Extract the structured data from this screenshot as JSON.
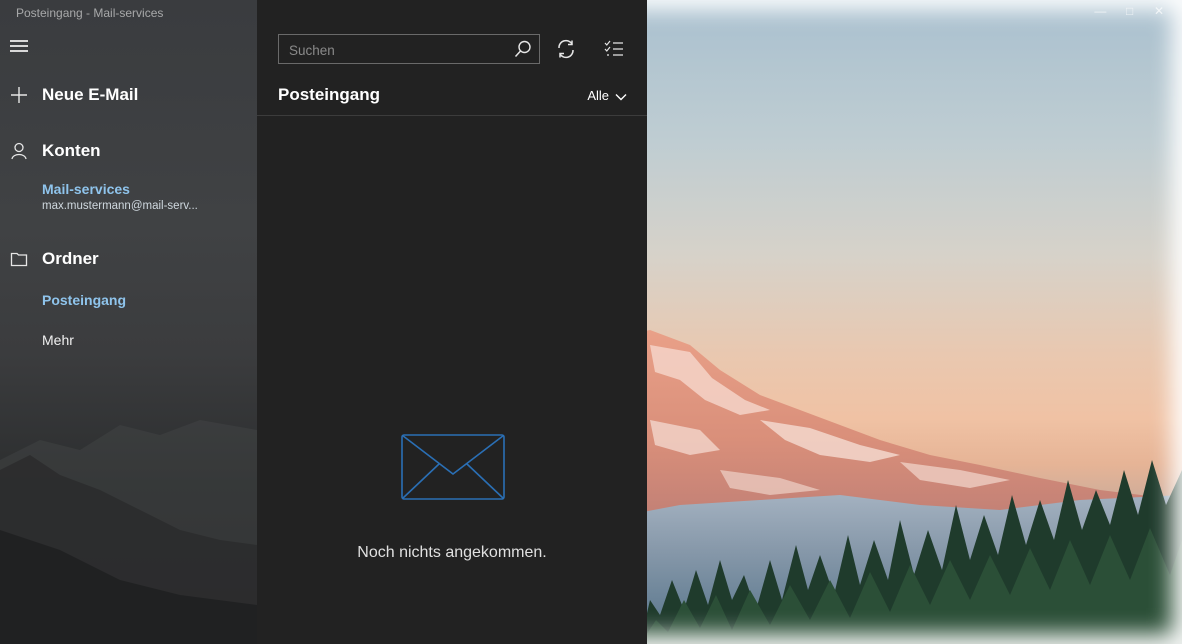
{
  "window": {
    "title": "Posteingang - Mail-services",
    "controls": [
      "—",
      "□",
      "✕"
    ]
  },
  "nav": {
    "menu_icon": "hamburger-icon",
    "new_mail": {
      "label": "Neue E-Mail",
      "icon": "plus-icon"
    },
    "accounts": {
      "label": "Konten",
      "icon": "person-icon",
      "items": [
        {
          "name": "Mail-services",
          "email": "max.mustermann@mail-serv..."
        }
      ]
    },
    "folders": {
      "label": "Ordner",
      "icon": "folder-icon",
      "items": [
        {
          "label": "Posteingang",
          "selected": true
        },
        {
          "label": "Mehr",
          "selected": false
        }
      ]
    },
    "accent_color": "#8fc4ec"
  },
  "list": {
    "search": {
      "placeholder": "Suchen",
      "value": "",
      "icon": "search-icon"
    },
    "sync_icon": "sync-icon",
    "select_icon": "selection-mode-icon",
    "header": "Posteingang",
    "filter": {
      "label": "Alle",
      "icon": "chevron-down-icon"
    },
    "empty_state": {
      "icon": "envelope-icon",
      "text": "Noch nichts angekommen."
    },
    "envelope_color": "#2a6fb5"
  }
}
